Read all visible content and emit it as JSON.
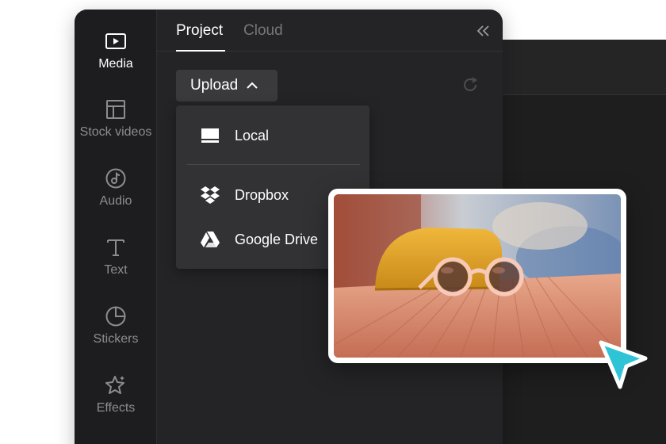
{
  "sidebar": {
    "items": [
      {
        "label": "Media",
        "icon": "media-play-icon",
        "active": true
      },
      {
        "label": "Stock videos",
        "icon": "layout-grid-icon",
        "active": false
      },
      {
        "label": "Audio",
        "icon": "music-note-icon",
        "active": false
      },
      {
        "label": "Text",
        "icon": "text-t-icon",
        "active": false
      },
      {
        "label": "Stickers",
        "icon": "sticker-icon",
        "active": false
      },
      {
        "label": "Effects",
        "icon": "sparkle-star-icon",
        "active": false
      }
    ]
  },
  "tabs": [
    {
      "label": "Project",
      "active": true
    },
    {
      "label": "Cloud",
      "active": false
    }
  ],
  "toolbar": {
    "upload_label": "Upload",
    "collapse_icon": "double-chevron-left-icon",
    "refresh_icon": "refresh-icon"
  },
  "upload_menu": {
    "items": [
      {
        "label": "Local",
        "icon": "monitor-icon"
      },
      {
        "label": "Dropbox",
        "icon": "dropbox-icon"
      },
      {
        "label": "Google Drive",
        "icon": "google-drive-icon"
      }
    ]
  },
  "preview": {
    "image": "sunglasses-on-case-photo",
    "pointer_icon": "cursor-arrow-icon",
    "pointer_color": "#2ec4d6"
  },
  "colors": {
    "panel_bg": "#242426",
    "sidebar_bg": "#1d1d1f",
    "menu_bg": "#323235",
    "accent": "#2ec4d6"
  }
}
